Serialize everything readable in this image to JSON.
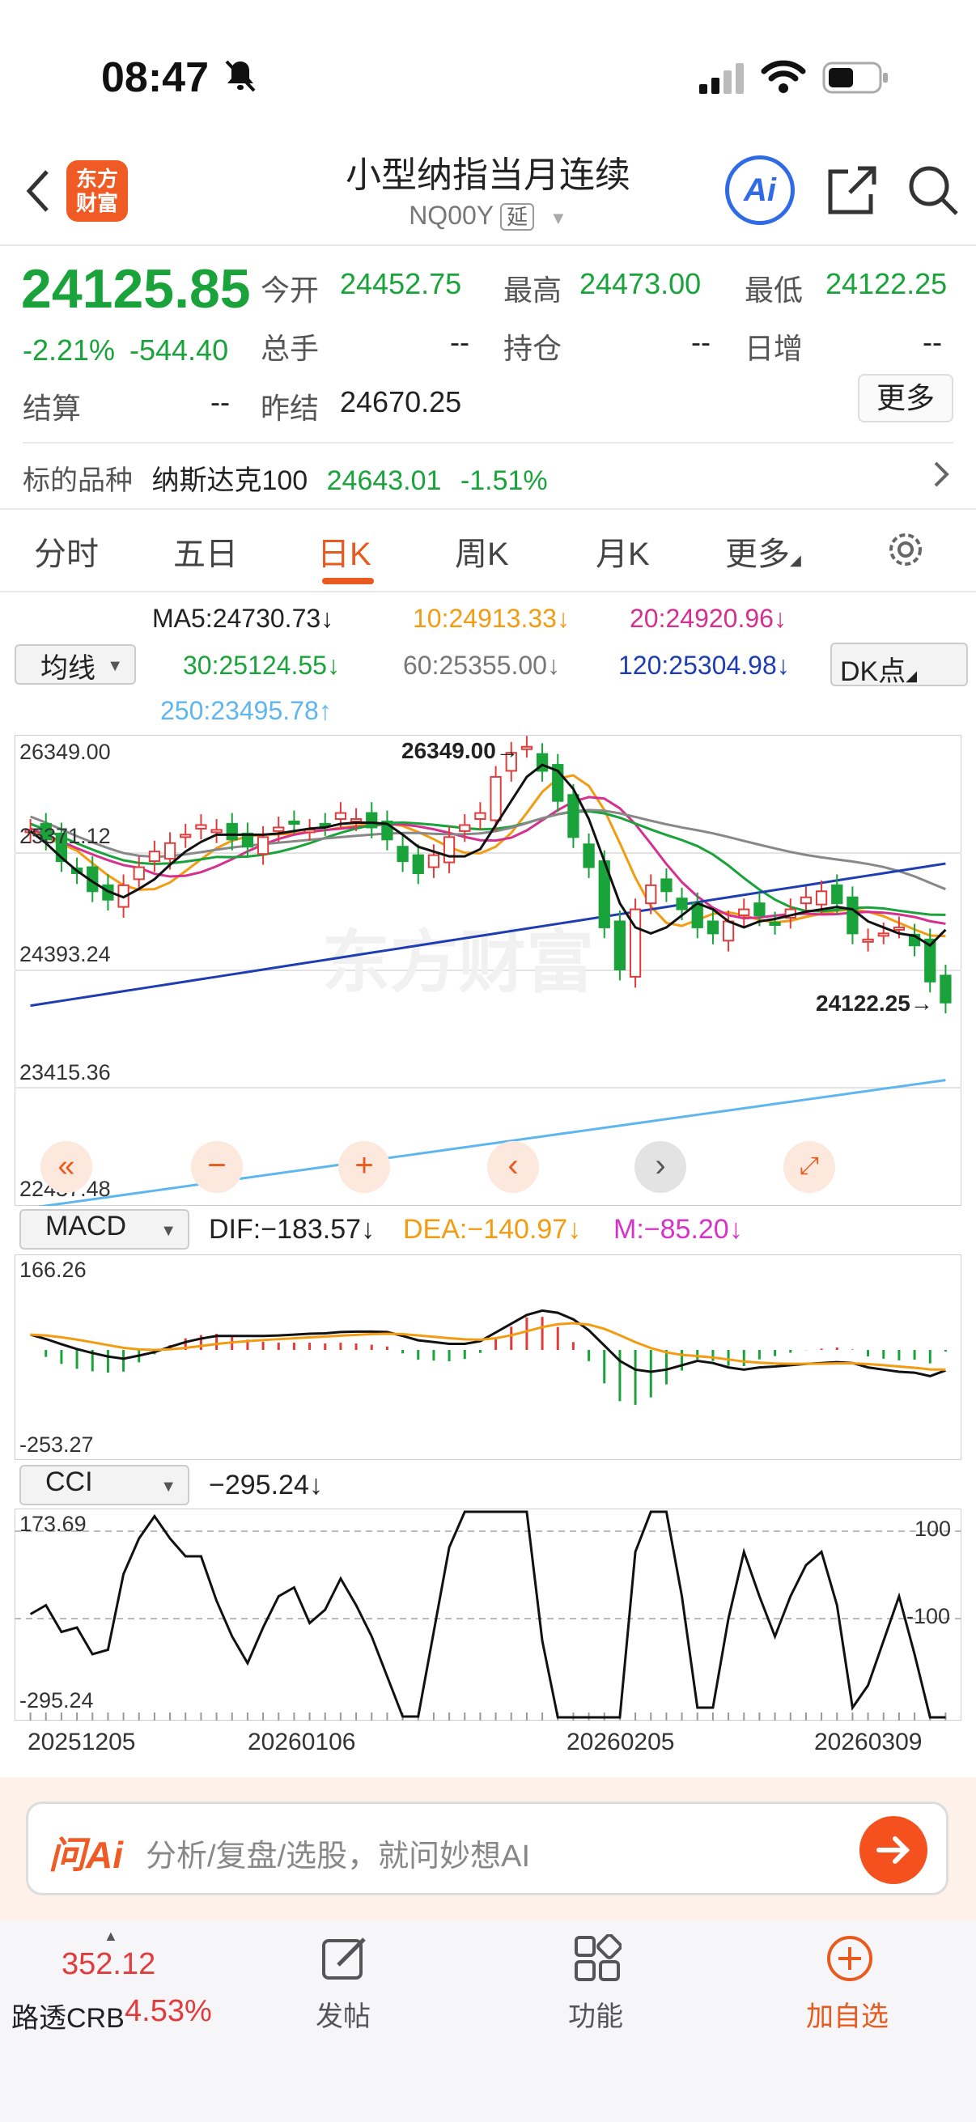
{
  "status": {
    "time": "08:47"
  },
  "nav": {
    "logo_line1": "东方",
    "logo_line2": "财富",
    "title": "小型纳指当月连续",
    "code": "NQ00Y",
    "delay_badge": "延",
    "ai_label": "Ai"
  },
  "quote": {
    "price": "24125.85",
    "change_pct": "-2.21%",
    "change_abs": "-544.40",
    "open_label": "今开",
    "open": "24452.75",
    "high_label": "最高",
    "high": "24473.00",
    "low_label": "最低",
    "low": "24122.25",
    "volume_label": "总手",
    "volume": "--",
    "oi_label": "持仓",
    "oi": "--",
    "daily_inc_label": "日增",
    "daily_inc": "--",
    "settle_label": "结算",
    "settle": "--",
    "prev_settle_label": "昨结",
    "prev_settle": "24670.25",
    "more_label": "更多"
  },
  "underlying": {
    "label": "标的品种",
    "name": "纳斯达克100",
    "price": "24643.01",
    "pct": "-1.51%"
  },
  "tabs": [
    "分时",
    "五日",
    "日K",
    "周K",
    "月K",
    "更多"
  ],
  "ma_bar": {
    "selector": "均线",
    "ma5": "MA5:24730.73↓",
    "ma10": "10:24913.33↓",
    "ma20": "20:24920.96↓",
    "ma30": "30:25124.55↓",
    "ma60": "60:25355.00↓",
    "ma120": "120:25304.98↓",
    "ma250": "250:23495.78↑",
    "dk": "DK点"
  },
  "kchart": {
    "y_labels": [
      "26349.00",
      "25371.12",
      "24393.24",
      "23415.36",
      "22437.48"
    ],
    "high_note": "26349.00→",
    "low_note": "24122.25→",
    "watermark": "东方财富"
  },
  "macd": {
    "selector": "MACD",
    "dif": "DIF:−183.57↓",
    "dea": "DEA:−140.97↓",
    "m": "M:−85.20↓",
    "top": "166.26",
    "bottom": "-253.27"
  },
  "cci": {
    "selector": "CCI",
    "value": "−295.24↓",
    "top": "173.69",
    "bottom": "-295.24",
    "l100": "100",
    "lm100": "-100"
  },
  "dates": [
    "20251205",
    "20260106",
    "20260205",
    "20260309"
  ],
  "ai_bar": {
    "logo": "问Ai",
    "placeholder": "分析/复盘/选股，就问妙想AI"
  },
  "bottom": {
    "crb_value": "352.12",
    "crb_label": "路透CRB",
    "crb_pct": "4.53%",
    "post": "发帖",
    "func": "功能",
    "add": "加自选"
  },
  "colors": {
    "up": "#e23b3b",
    "down": "#19a33a",
    "accent": "#e85a1e"
  },
  "chart_data": {
    "type": "candlestick",
    "price_range": [
      22437.48,
      26349.0
    ],
    "closes": [
      25560,
      25480,
      25300,
      25200,
      25050,
      24980,
      25100,
      25250,
      25380,
      25450,
      25520,
      25600,
      25560,
      25480,
      25420,
      25500,
      25580,
      25620,
      25560,
      25600,
      25700,
      25650,
      25580,
      25480,
      25300,
      25200,
      25350,
      25500,
      25600,
      25700,
      26000,
      26200,
      26250,
      26050,
      25800,
      25500,
      25250,
      24750,
      24400,
      24900,
      25100,
      25050,
      24900,
      24750,
      24700,
      24800,
      24900,
      24850,
      24780,
      24900,
      25000,
      25050,
      24950,
      24700,
      24650,
      24700,
      24750,
      24600,
      24300,
      24125.85
    ],
    "ma5": [
      25550,
      25450,
      25330,
      25220,
      25130,
      25050,
      25000,
      25070,
      25150,
      25270,
      25380,
      25460,
      25520,
      25520,
      25520,
      25520,
      25530,
      25550,
      25570,
      25580,
      25610,
      25620,
      25620,
      25610,
      25520,
      25420,
      25380,
      25340,
      25340,
      25400,
      25600,
      25800,
      26000,
      26100,
      26050,
      25900,
      25650,
      25300,
      24950,
      24750,
      24700,
      24750,
      24850,
      24950,
      24900,
      24800,
      24750,
      24800,
      24820,
      24850,
      24880,
      24900,
      24920,
      24900,
      24800,
      24750,
      24700,
      24680,
      24600,
      24730.73
    ]
  }
}
